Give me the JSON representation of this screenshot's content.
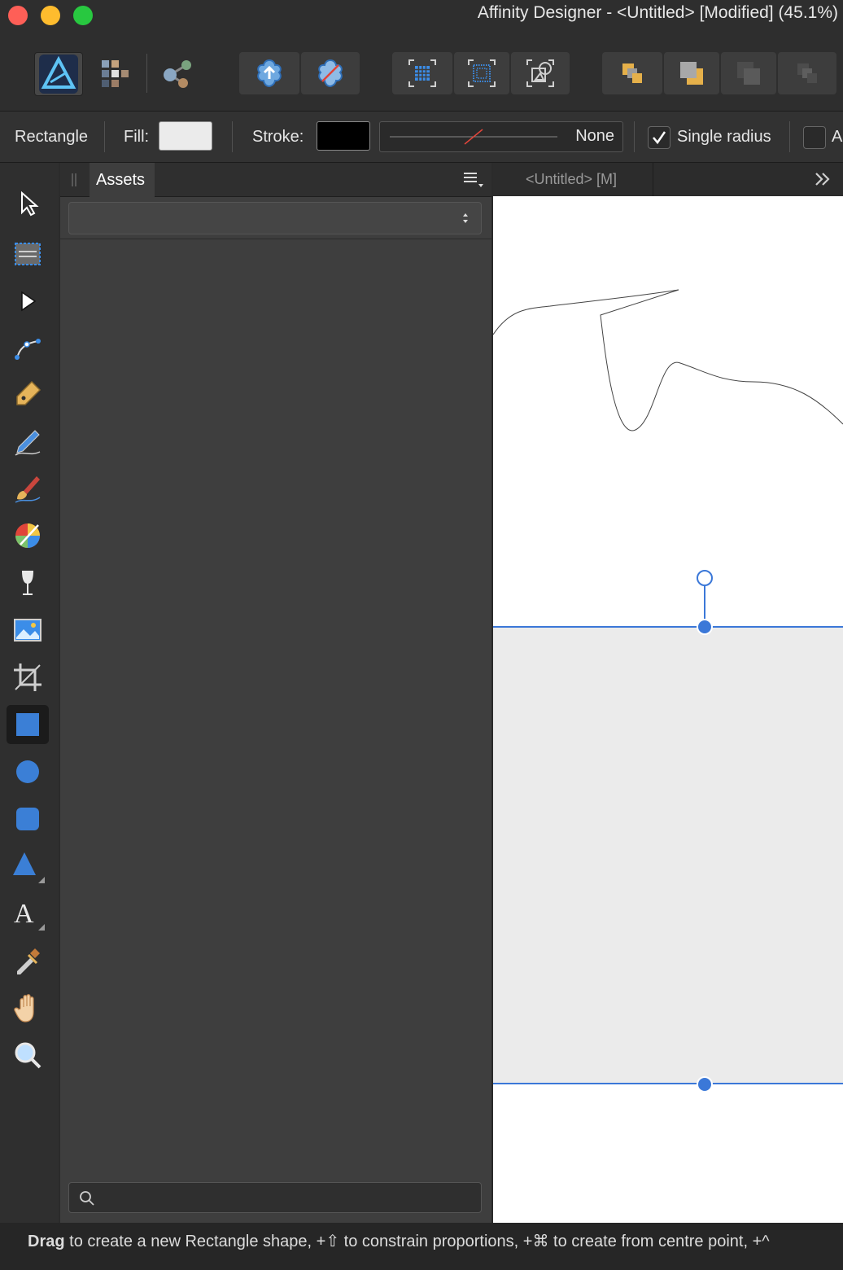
{
  "window": {
    "title": "Affinity Designer - <Untitled> [Modified] (45.1%)",
    "controls": {
      "close_color": "#fe5f57",
      "minimize_color": "#febc2e",
      "zoom_color": "#28c840"
    }
  },
  "toolbar": {
    "personas": [
      "designer-persona-icon",
      "pixel-persona-icon",
      "export-persona-icon"
    ],
    "groups": [
      "boolean-operations",
      "snapping-grid",
      "arrange-order"
    ]
  },
  "context": {
    "tool_name": "Rectangle",
    "fill_label": "Fill:",
    "fill_color": "#ebebeb",
    "stroke_label": "Stroke:",
    "stroke_color": "#000000",
    "stroke_style": "None",
    "single_radius_label": "Single radius",
    "single_radius_checked": true,
    "truncated_label": "A"
  },
  "assets": {
    "tab_label": "Assets",
    "category_value": "",
    "search_placeholder": ""
  },
  "document": {
    "tab_label": "<Untitled> [M]",
    "accent": "#3b78d8"
  },
  "status": {
    "bold": "Drag",
    "text": " to create a new Rectangle shape, +⇧ to constrain proportions, +⌘ to create from centre point, +^"
  }
}
